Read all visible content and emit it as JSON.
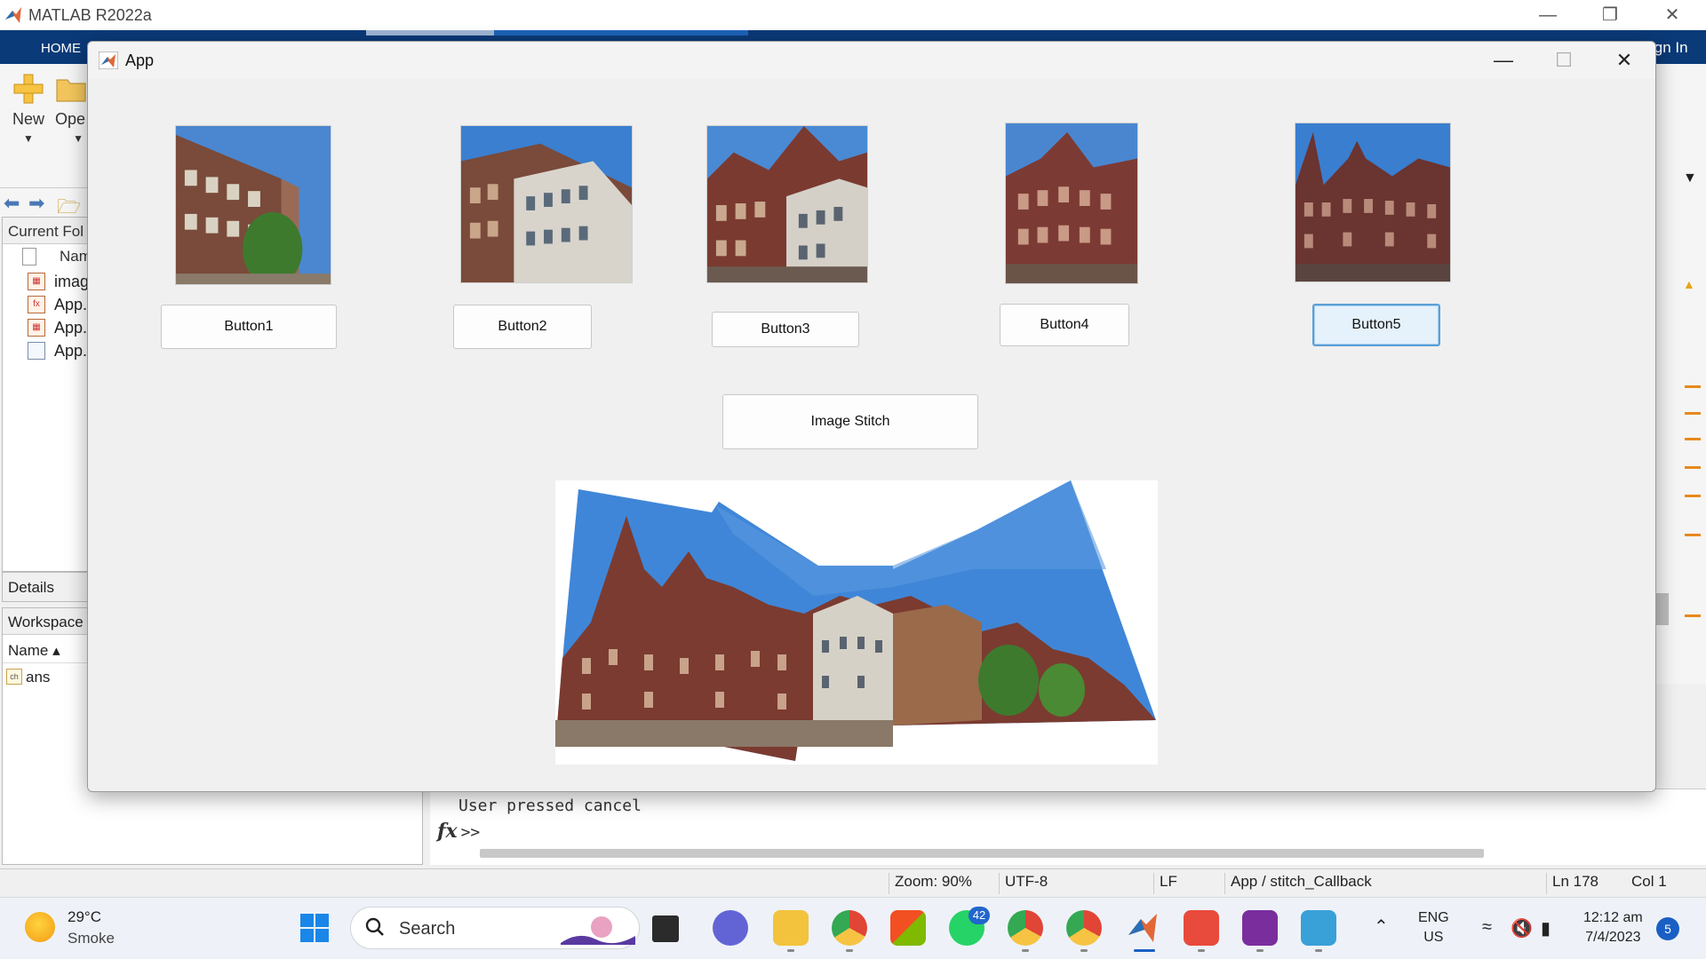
{
  "matlab": {
    "title": "MATLAB R2022a",
    "tab_home": "HOME",
    "sign_in": "ign In",
    "ribbon": {
      "new_label": "New",
      "open_label": "Ope"
    },
    "current_folder": {
      "header": "Current Fol",
      "name_col": "Nam",
      "files": [
        "imag",
        "App.",
        "App.",
        "App."
      ]
    },
    "details_label": "Details",
    "workspace": {
      "header": "Workspace",
      "name_col": "Name ▴",
      "vars": [
        "ans"
      ]
    },
    "command_window": {
      "output": "User pressed cancel",
      "prompt": ">>",
      "fx": "fx"
    },
    "status_bar": {
      "zoom": "Zoom: 90%",
      "encoding": "UTF-8",
      "line_ending": "LF",
      "function": "App / stitch_Callback",
      "line": "Ln  178",
      "col": "Col  1"
    }
  },
  "app": {
    "title": "App",
    "buttons": [
      "Button1",
      "Button2",
      "Button3",
      "Button4",
      "Button5"
    ],
    "stitch_button": "Image Stitch",
    "focused_button": "Button5"
  },
  "taskbar": {
    "weather": {
      "temp": "29°C",
      "condition": "Smoke"
    },
    "search_placeholder": "Search",
    "whatsapp_badge": "42",
    "language": [
      "ENG",
      "US"
    ],
    "time": "12:12 am",
    "date": "7/4/2023",
    "notifications": "5"
  },
  "colors": {
    "matlab_blue": "#0b3a78",
    "focus_blue": "#5a9fd6",
    "taskbar_bg": "#eef2f8"
  }
}
